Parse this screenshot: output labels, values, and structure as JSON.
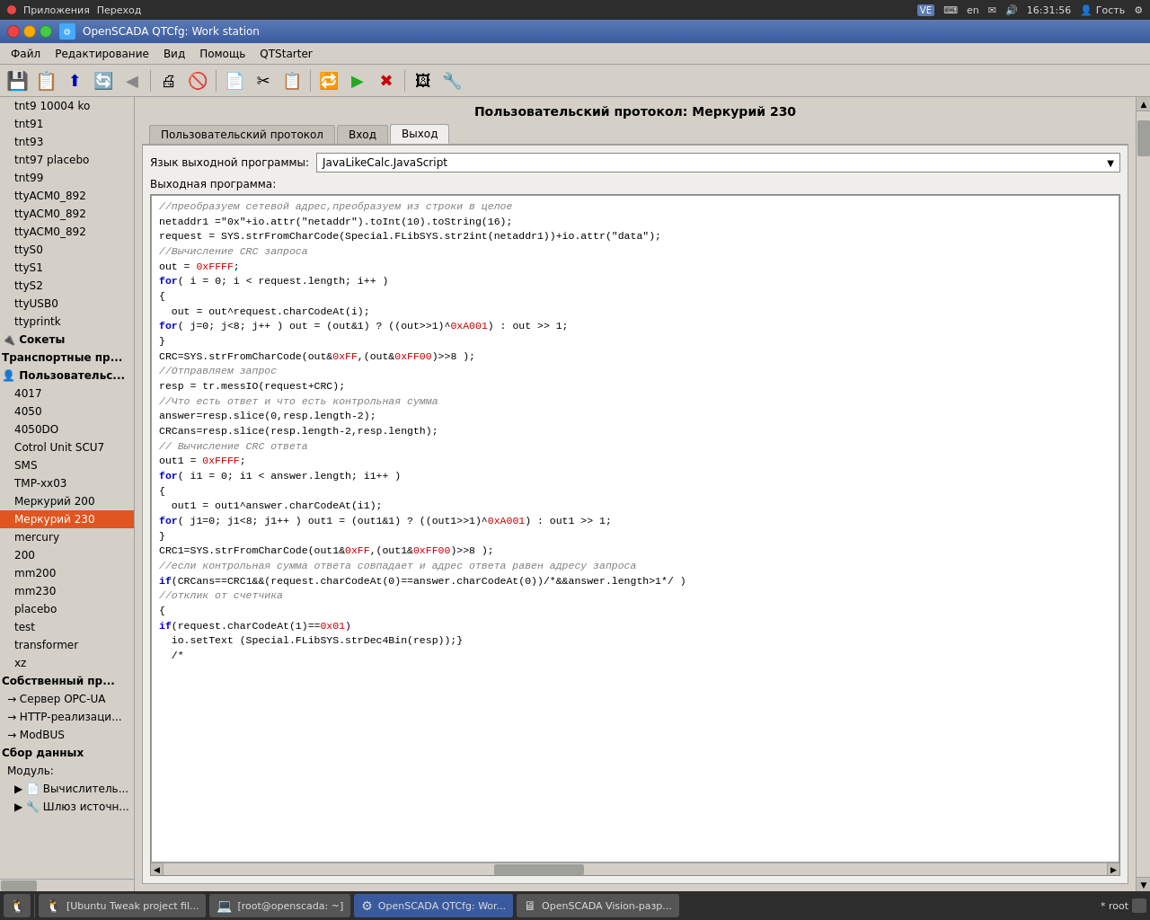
{
  "system_bar": {
    "left": [
      "Приложения",
      "Переход"
    ],
    "right_items": [
      "VE",
      "en",
      "✉",
      "🔊",
      "16:31:56",
      "Гость"
    ],
    "icon_label": "VE"
  },
  "title_bar": {
    "title": "OpenSCADA QTCfg: Work station"
  },
  "menu": {
    "items": [
      "Файл",
      "Редактирование",
      "Вид",
      "Помощь",
      "QTStarter"
    ]
  },
  "content": {
    "title": "Пользовательский протокол: Меркурий 230",
    "tabs": [
      {
        "label": "Пользовательский протокол",
        "active": false
      },
      {
        "label": "Вход",
        "active": false
      },
      {
        "label": "Выход",
        "active": true
      }
    ],
    "lang_label": "Язык выходной программы:",
    "lang_value": "JavaLikeCalc.JavaScript",
    "code_label": "Выходная программа:",
    "code_lines": [
      {
        "type": "comment",
        "text": "//преобразуем сетевой адрес,преобразуем из строки в целое"
      },
      {
        "type": "normal",
        "text": "netaddr1 =\"0x\"+io.attr(\"netaddr\").toInt(10).toString(16);"
      },
      {
        "type": "normal",
        "text": "request = SYS.strFromCharCode(Special.FLibSYS.str2int(netaddr1))+io.attr(\"data\");"
      },
      {
        "type": "comment",
        "text": "//Вычисление CRC запроса"
      },
      {
        "type": "normal",
        "text": "out = 0xFFFF;"
      },
      {
        "type": "keyword",
        "text": "for",
        "rest": "( i = 0; i < request.length; i++ )"
      },
      {
        "type": "normal",
        "text": "{"
      },
      {
        "type": "normal",
        "text": "  out = out^request.charCodeAt(i);"
      },
      {
        "type": "keyword",
        "text": "for",
        "rest": "( j=0; j<8; j++ ) out = (out&1) ? ((out>>1)^0xA001) : out >> 1;"
      },
      {
        "type": "normal",
        "text": "}"
      },
      {
        "type": "normal",
        "text": "CRC=SYS.strFromCharCode(out&0xFF,(out&0xFF00)>>8 );"
      },
      {
        "type": "comment",
        "text": "//Отправляем запрос"
      },
      {
        "type": "normal",
        "text": "resp = tr.messIO(request+CRC);"
      },
      {
        "type": "comment",
        "text": "//Что есть ответ и что есть контрольная сумма"
      },
      {
        "type": "normal",
        "text": "answer=resp.slice(0,resp.length-2);"
      },
      {
        "type": "normal",
        "text": "CRCans=resp.slice(resp.length-2,resp.length);"
      },
      {
        "type": "comment",
        "text": "// Вычисление CRC ответа"
      },
      {
        "type": "normal",
        "text": "out1 = 0xFFFF;"
      },
      {
        "type": "keyword",
        "text": "for",
        "rest": "( i1 = 0; i1 < answer.length; i1++ )"
      },
      {
        "type": "normal",
        "text": "{"
      },
      {
        "type": "normal",
        "text": "  out1 = out1^answer.charCodeAt(i1);"
      },
      {
        "type": "keyword",
        "text": "for",
        "rest": "( j1=0; j1<8; j1++ ) out1 = (out1&1) ? ((out1>>1)^0xA001) : out1 >> 1;"
      },
      {
        "type": "normal",
        "text": "}"
      },
      {
        "type": "normal",
        "text": "CRC1=SYS.strFromCharCode(out1&0xFF,(out1&0xFF00)>>8 );"
      },
      {
        "type": "normal",
        "text": ""
      },
      {
        "type": "comment",
        "text": "//если контрольная сумма ответа совпадает и адрес ответа равен адресу запроса"
      },
      {
        "type": "keyword",
        "text": "if",
        "rest": "(CRCans==CRC1&&(request.charCodeAt(0)==answer.charCodeAt(0))/*&&answer.length>1*/ )"
      },
      {
        "type": "comment",
        "text": "//отклик от счетчика"
      },
      {
        "type": "normal",
        "text": "{"
      },
      {
        "type": "keyword",
        "text": "if",
        "rest": "(request.charCodeAt(1)==0x01)"
      },
      {
        "type": "normal",
        "text": "  io.setText (Special.FLibSYS.strDec4Bin(resp));}"
      },
      {
        "type": "normal",
        "text": ""
      },
      {
        "type": "normal",
        "text": ""
      },
      {
        "type": "normal",
        "text": ""
      },
      {
        "type": "normal",
        "text": ""
      },
      {
        "type": "normal",
        "text": ""
      },
      {
        "type": "normal",
        "text": ""
      },
      {
        "type": "normal",
        "text": "  /*"
      }
    ]
  },
  "sidebar": {
    "items": [
      {
        "label": "tnt9 10004 ko",
        "indent": 1
      },
      {
        "label": "tnt91",
        "indent": 1
      },
      {
        "label": "tnt93",
        "indent": 1
      },
      {
        "label": "tnt97 placebo",
        "indent": 1
      },
      {
        "label": "tnt99",
        "indent": 1
      },
      {
        "label": "ttyACM0_892",
        "indent": 1
      },
      {
        "label": "ttyACM0_892",
        "indent": 1
      },
      {
        "label": "ttyACM0_892",
        "indent": 1
      },
      {
        "label": "ttyS0",
        "indent": 1
      },
      {
        "label": "ttyS1",
        "indent": 1
      },
      {
        "label": "ttyS2",
        "indent": 1
      },
      {
        "label": "ttyUSB0",
        "indent": 1
      },
      {
        "label": "ttyprintk",
        "indent": 1
      },
      {
        "label": "🔌 Сокеты",
        "indent": 0,
        "section": true
      },
      {
        "label": "Транспортные пр...",
        "indent": 0,
        "section": true
      },
      {
        "label": "👤 Пользовательс...",
        "indent": 0,
        "section": true
      },
      {
        "label": "4017",
        "indent": 1
      },
      {
        "label": "4050",
        "indent": 1
      },
      {
        "label": "4050DO",
        "indent": 1
      },
      {
        "label": "Cotrol Unit SCU7",
        "indent": 1
      },
      {
        "label": "SMS",
        "indent": 1
      },
      {
        "label": "TMP-xx03",
        "indent": 1
      },
      {
        "label": "Меркурий 200",
        "indent": 1
      },
      {
        "label": "Меркурий 230",
        "indent": 1,
        "selected": true
      },
      {
        "label": "mercury",
        "indent": 1
      },
      {
        "label": "200",
        "indent": 1
      },
      {
        "label": "mm200",
        "indent": 1
      },
      {
        "label": "mm230",
        "indent": 1
      },
      {
        "label": "placebo",
        "indent": 1
      },
      {
        "label": "test",
        "indent": 1
      },
      {
        "label": "transformer",
        "indent": 1
      },
      {
        "label": "xz",
        "indent": 1
      },
      {
        "label": "Собственный пр...",
        "indent": 0,
        "section": true
      },
      {
        "label": "→ Сервер OPC-UA",
        "indent": 0
      },
      {
        "label": "→ HTTP-реализаци...",
        "indent": 0
      },
      {
        "label": "→ ModBUS",
        "indent": 0
      },
      {
        "label": "Сбор данных",
        "indent": 0,
        "section": true
      },
      {
        "label": "Модуль:",
        "indent": 0
      },
      {
        "label": "▶ 📄 Вычислитель...",
        "indent": 1
      },
      {
        "label": "▶ 🔧 Шлюз источн...",
        "indent": 1
      }
    ]
  },
  "taskbar": {
    "items": [
      {
        "label": "[Ubuntu Tweak project fil...",
        "icon": "🐧",
        "active": false
      },
      {
        "label": "[root@openscada: ~]",
        "icon": "💻",
        "active": false
      },
      {
        "label": "OpenSCADA QTCfg: Wor...",
        "icon": "⚙",
        "active": true
      },
      {
        "label": "OpenSCADA Vision-разр...",
        "icon": "🖥",
        "active": false
      }
    ],
    "status": "* root"
  }
}
